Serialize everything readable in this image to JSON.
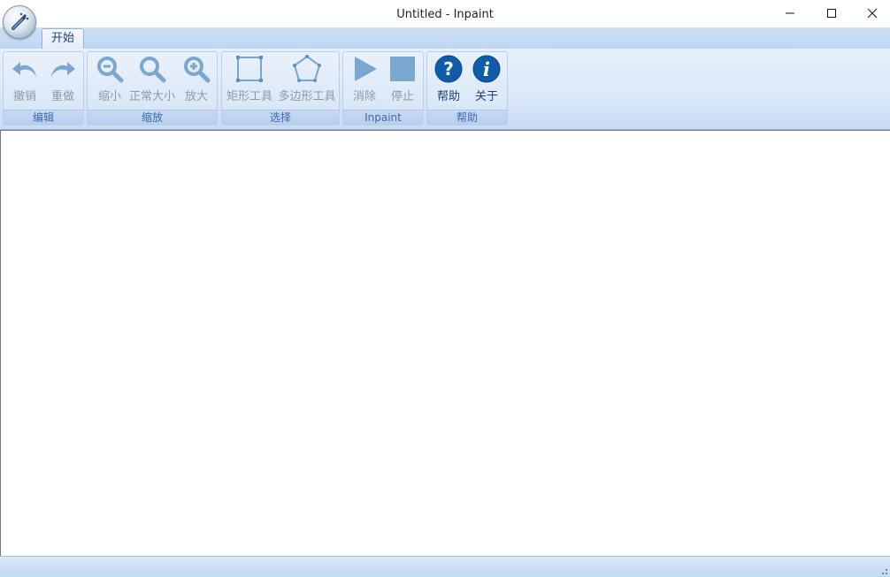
{
  "window": {
    "title": "Untitled - Inpaint",
    "controls": [
      "minimize-icon",
      "maximize-icon",
      "close-icon"
    ]
  },
  "app_button": {
    "icon": "magic-wand-icon"
  },
  "tabs": [
    {
      "label": "开始",
      "selected": true
    }
  ],
  "ribbon": {
    "groups": [
      {
        "label": "编辑",
        "buttons": [
          {
            "label": "撤销",
            "icon": "undo-icon",
            "enabled": false
          },
          {
            "label": "重做",
            "icon": "redo-icon",
            "enabled": false
          }
        ]
      },
      {
        "label": "缩放",
        "buttons": [
          {
            "label": "缩小",
            "icon": "zoom-out-icon",
            "enabled": false
          },
          {
            "label": "正常大小",
            "icon": "zoom-normal-icon",
            "enabled": false
          },
          {
            "label": "放大",
            "icon": "zoom-in-icon",
            "enabled": false
          }
        ]
      },
      {
        "label": "选择",
        "buttons": [
          {
            "label": "矩形工具",
            "icon": "rectangle-icon",
            "enabled": false
          },
          {
            "label": "多边形工具",
            "icon": "polygon-icon",
            "enabled": false
          }
        ]
      },
      {
        "label": "Inpaint",
        "buttons": [
          {
            "label": "消除",
            "icon": "play-icon",
            "enabled": false
          },
          {
            "label": "停止",
            "icon": "stop-icon",
            "enabled": false
          }
        ]
      },
      {
        "label": "帮助",
        "buttons": [
          {
            "label": "帮助",
            "icon": "help-icon",
            "enabled": true
          },
          {
            "label": "关于",
            "icon": "info-icon",
            "enabled": true
          }
        ]
      }
    ]
  },
  "colors": {
    "ribbon_bg": "#dbe8f8",
    "disabled_icon": "#7aa7cf",
    "enabled_icon": "#0f5da8",
    "group_label": "#3e6aaa"
  }
}
